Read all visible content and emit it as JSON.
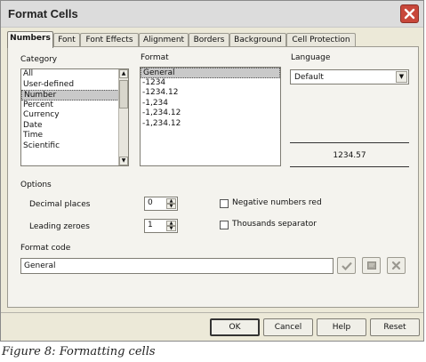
{
  "window": {
    "title": "Format Cells"
  },
  "tabs": [
    {
      "label": "Numbers"
    },
    {
      "label": "Font"
    },
    {
      "label": "Font Effects"
    },
    {
      "label": "Alignment"
    },
    {
      "label": "Borders"
    },
    {
      "label": "Background"
    },
    {
      "label": "Cell Protection"
    }
  ],
  "active_tab": "Numbers",
  "category": {
    "label": "Category",
    "items": [
      "All",
      "User-defined",
      "Number",
      "Percent",
      "Currency",
      "Date",
      "Time",
      "Scientific"
    ],
    "selected": "Number"
  },
  "format": {
    "label": "Format",
    "items": [
      "General",
      "-1234",
      "-1234.12",
      "-1,234",
      "-1,234.12",
      "-1,234.12"
    ],
    "selected": "General"
  },
  "language": {
    "label": "Language",
    "value": "Default"
  },
  "preview": {
    "value": "1234.57"
  },
  "options": {
    "label": "Options",
    "decimal_places_label": "Decimal places",
    "decimal_places_value": "0",
    "leading_zeroes_label": "Leading zeroes",
    "leading_zeroes_value": "1",
    "negative_red_label": "Negative numbers red",
    "negative_red_checked": false,
    "thousands_separator_label": "Thousands separator",
    "thousands_separator_checked": false
  },
  "format_code": {
    "label": "Format code",
    "value": "General"
  },
  "buttons": {
    "ok": "OK",
    "cancel": "Cancel",
    "help": "Help",
    "reset": "Reset"
  },
  "caption": "Figure 8: Formatting cells",
  "icons": {
    "close": "close-icon",
    "accept": "checkmark-icon",
    "comment": "comment-icon",
    "delete": "delete-icon",
    "scroll_up": "scroll-up-icon",
    "scroll_down": "scroll-down-icon",
    "dropdown": "chevron-down-icon"
  },
  "colors": {
    "close_button": "#c8473a",
    "dialog_bg": "#ece9d8",
    "selection": "#c9c9c9"
  }
}
